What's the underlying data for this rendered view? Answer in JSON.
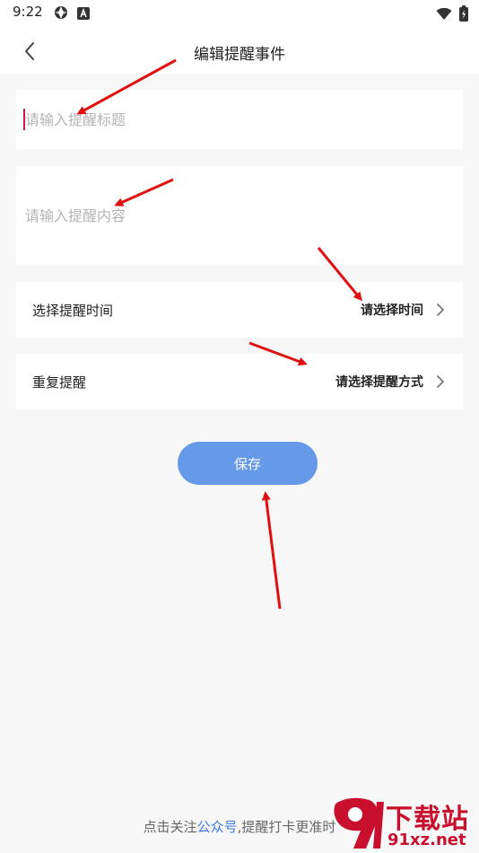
{
  "status_bar": {
    "time": "9:22"
  },
  "nav": {
    "title": "编辑提醒事件"
  },
  "form": {
    "title_placeholder": "请输入提醒标题",
    "content_placeholder": "请输入提醒内容",
    "time_row": {
      "label": "选择提醒时间",
      "value": "请选择时间"
    },
    "repeat_row": {
      "label": "重复提醒",
      "value": "请选择提醒方式"
    },
    "save_label": "保存"
  },
  "footer": {
    "prefix": "点击关注",
    "link": "公众号",
    "suffix": ",提醒打卡更准时"
  },
  "watermark": {
    "text": "下载站",
    "url": "91xz.net"
  },
  "colors": {
    "accent": "#6699e8",
    "link": "#3d7ce0",
    "caret": "#d0185a",
    "annotation_arrow": "#e01010",
    "watermark": "#c8102e"
  }
}
